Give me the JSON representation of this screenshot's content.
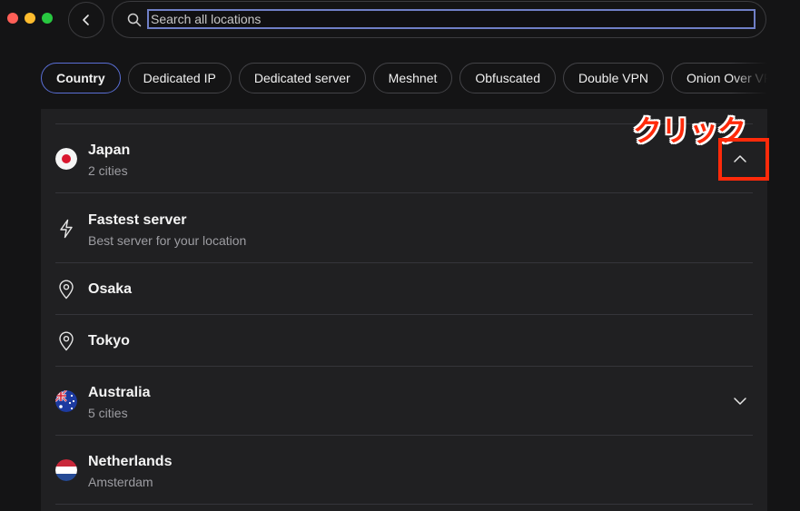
{
  "window": {
    "controls": [
      "close",
      "minimize",
      "zoom"
    ],
    "colors": {
      "close": "#ff5f57",
      "minimize": "#febc2e",
      "zoom": "#28c840"
    }
  },
  "header": {
    "back_icon": "chevron-left-icon",
    "search": {
      "placeholder": "Search all locations",
      "value": "",
      "icon": "search-icon"
    }
  },
  "filters": {
    "active": "Country",
    "accent": "#5a6fd6",
    "chips": [
      "Country",
      "Dedicated IP",
      "Dedicated server",
      "Meshnet",
      "Obfuscated",
      "Double VPN",
      "Onion Over VPN"
    ]
  },
  "locations": {
    "japan": {
      "name": "Japan",
      "detail": "2 cities",
      "expanded": true,
      "flag_icon": "japan-flag-icon"
    },
    "japan_children": [
      {
        "title": "Fastest server",
        "subtitle": "Best server for your location",
        "icon": "lightning-icon"
      },
      {
        "title": "Osaka",
        "icon": "location-pin-icon"
      },
      {
        "title": "Tokyo",
        "icon": "location-pin-icon"
      }
    ],
    "australia": {
      "name": "Australia",
      "detail": "5 cities",
      "expanded": false,
      "flag_icon": "australia-flag-icon"
    },
    "netherlands": {
      "name": "Netherlands",
      "detail": "Amsterdam",
      "flag_icon": "netherlands-flag-icon"
    }
  },
  "annotation": {
    "label": "クリック",
    "color": "#ff2a0a"
  }
}
